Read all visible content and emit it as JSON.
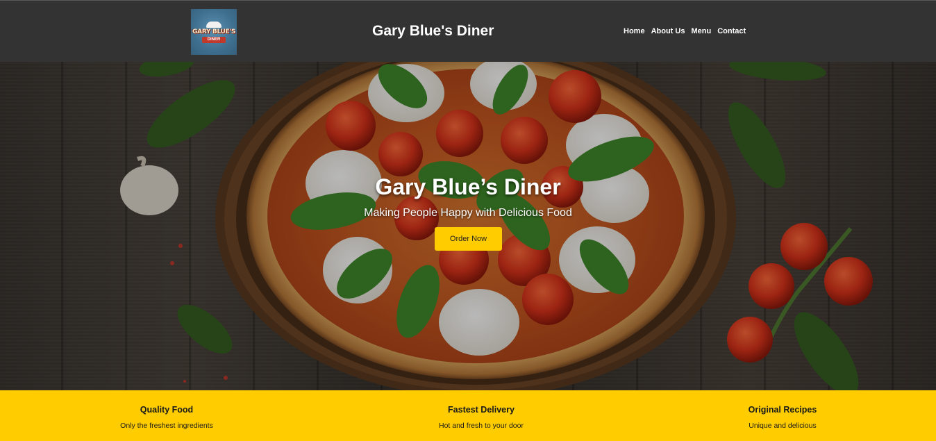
{
  "header": {
    "logo_text": "GARY BLUE'S",
    "logo_sub": "DINER",
    "title": "Gary Blue's Diner",
    "nav": [
      "Home",
      "About Us",
      "Menu",
      "Contact"
    ]
  },
  "hero": {
    "title": "Gary Blue’s Diner",
    "subtitle": "Making People Happy with Delicious Food",
    "cta_label": "Order Now"
  },
  "features": [
    {
      "title": "Quality Food",
      "text": "Only the freshest ingredients"
    },
    {
      "title": "Fastest Delivery",
      "text": "Hot and fresh to your door"
    },
    {
      "title": "Original Recipes",
      "text": "Unique and delicious"
    }
  ],
  "colors": {
    "header_bg": "#333333",
    "accent": "#ffcc00",
    "text_light": "#ffffff",
    "text_dark": "#1a1a1a"
  }
}
